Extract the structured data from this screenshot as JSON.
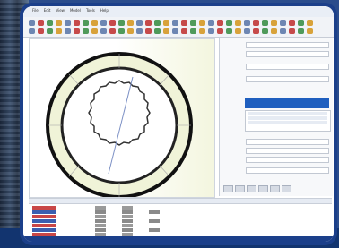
{
  "menu": [
    "File",
    "Edit",
    "View",
    "Model",
    "Tools",
    "Help"
  ],
  "panel": {
    "fields": [
      "",
      "",
      "",
      "",
      "",
      "",
      "",
      ""
    ],
    "selected_item": "",
    "list_items": [
      "",
      "",
      ""
    ]
  },
  "colors": {
    "frame": "#1b3f8a",
    "outer_ring": "#1a1a1a",
    "ring_highlight": "#e8edc8",
    "selection": "#1f5fbf"
  }
}
